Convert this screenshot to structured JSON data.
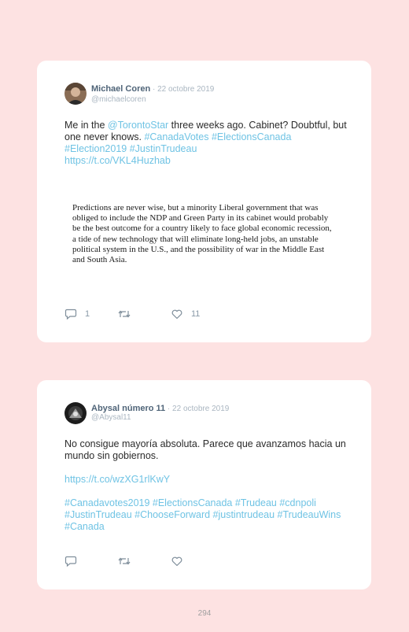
{
  "tweets": [
    {
      "author": "Michael Coren",
      "date": " · 22 octobre 2019",
      "handle": "@michaelcoren",
      "text_1": "Me in the ",
      "mention": "@TorontoStar",
      "text_2": " three weeks ago. Cabinet? Doubtful, but one never knows. ",
      "tags": "#CanadaVotes #ElectionsCanada #Election2019 #JustinTrudeau",
      "url": "https://t.co/VKL4Huzhab",
      "quote": "Predictions are never wise, but a minority Liberal government that was obliged to include the NDP and Green Party in its cabinet would probably be the best outcome for a country likely to face global economic recession, a tide of new technology that will eliminate long-held jobs, an unstable political system in the U.S., and the possibility of war in the Middle East and South Asia.",
      "replies": "1",
      "retweets": "",
      "likes": "11"
    },
    {
      "author": "Abysal número 11",
      "date": " · 22 octobre 2019",
      "handle": "@Abysal11",
      "text": "No consigue mayoría absoluta. Parece que avanzamos hacia un mundo sin gobiernos.",
      "url": "https://t.co/wzXG1rlKwY",
      "tags": "#Canadavotes2019 #ElectionsCanada #Trudeau #cdnpoli #JustinTrudeau #ChooseForward #justintrudeau #TrudeauWins #Canada",
      "replies": "",
      "retweets": "",
      "likes": ""
    }
  ],
  "page_number": "294",
  "colors": {
    "background": "#fde2e2",
    "card": "#ffffff",
    "link": "#6fc3e4",
    "icon": "#7f8e9b"
  },
  "icons": [
    "reply-icon",
    "retweet-icon",
    "like-icon"
  ]
}
